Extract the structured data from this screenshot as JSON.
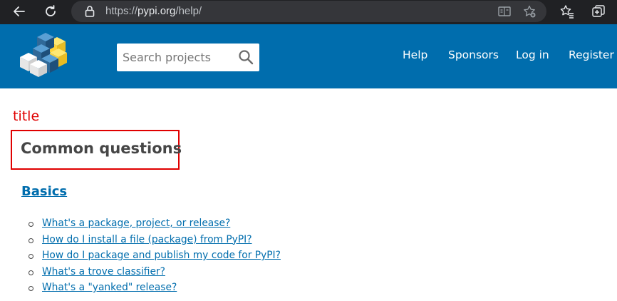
{
  "browser": {
    "url_prefix": "https://",
    "url_host": "pypi.org",
    "url_path": "/help/"
  },
  "header": {
    "search_placeholder": "Search projects",
    "nav": {
      "help": "Help",
      "sponsors": "Sponsors",
      "login": "Log in",
      "register": "Register"
    }
  },
  "annotation": {
    "label": "title",
    "color": "#e00000"
  },
  "main": {
    "title": "Common questions",
    "section_title": "Basics",
    "questions": [
      "What's a package, project, or release?",
      "How do I install a file (package) from PyPI?",
      "How do I package and publish my code for PyPI?",
      "What's a trove classifier?",
      "What's a \"yanked\" release?"
    ]
  },
  "colors": {
    "header_blue": "#006dad",
    "link_blue": "#006dad",
    "text_dark": "#464646",
    "browser_dark": "#202124"
  }
}
